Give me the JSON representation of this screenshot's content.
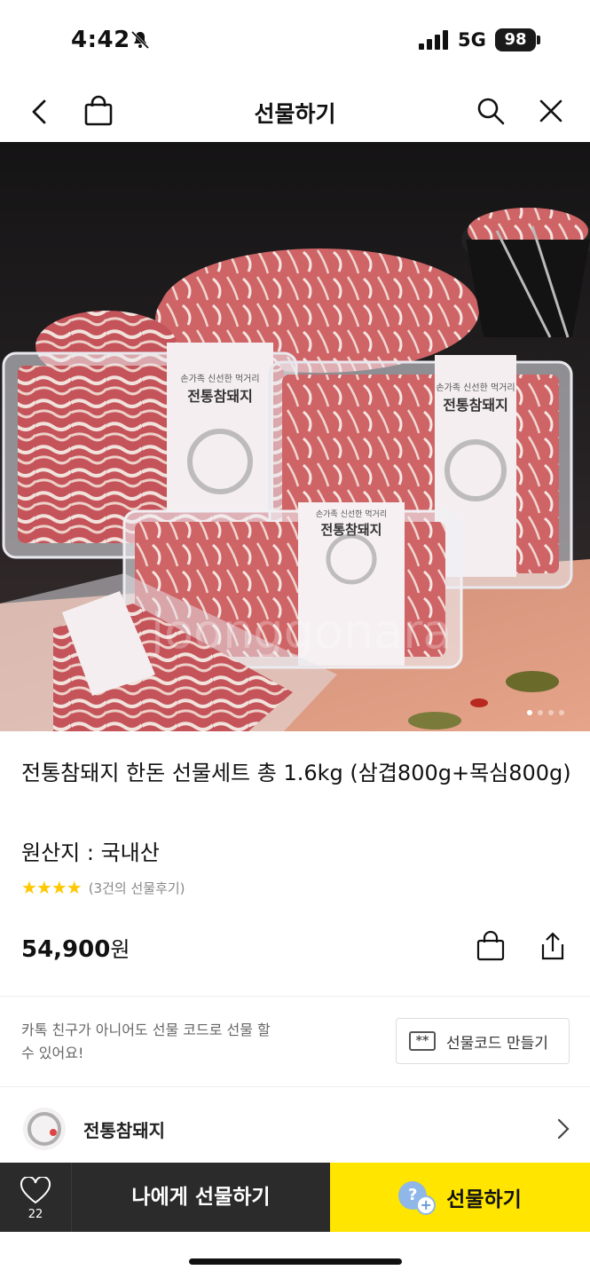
{
  "status_bar": {
    "time": "4:42",
    "network": "5G",
    "battery": "98"
  },
  "header": {
    "title": "선물하기"
  },
  "hero": {
    "package_label_top": "손가족 신선한 먹거리",
    "package_label_main": "전통참돼지",
    "watermark": "joonggonara",
    "page_dots": 4,
    "active_dot": 1
  },
  "product": {
    "name": "전통참돼지 한돈 선물세트 총 1.6kg (삼겹800g+목심800g)",
    "origin": "원산지 : 국내산",
    "stars": "★★★★",
    "review_text": "(3건의 선물후기)",
    "price": "54,900",
    "currency": "원"
  },
  "gift_code": {
    "info": "카톡 친구가 아니어도 선물 코드로 선물 할 수 있어요!",
    "button_label": "선물코드 만들기",
    "icon_text": "**"
  },
  "store": {
    "name": "전통참돼지"
  },
  "bottom_bar": {
    "like_count": "22",
    "self_gift_label": "나에게 선물하기",
    "gift_label": "선물하기",
    "gift_icon_q": "?",
    "gift_icon_plus": "+"
  }
}
